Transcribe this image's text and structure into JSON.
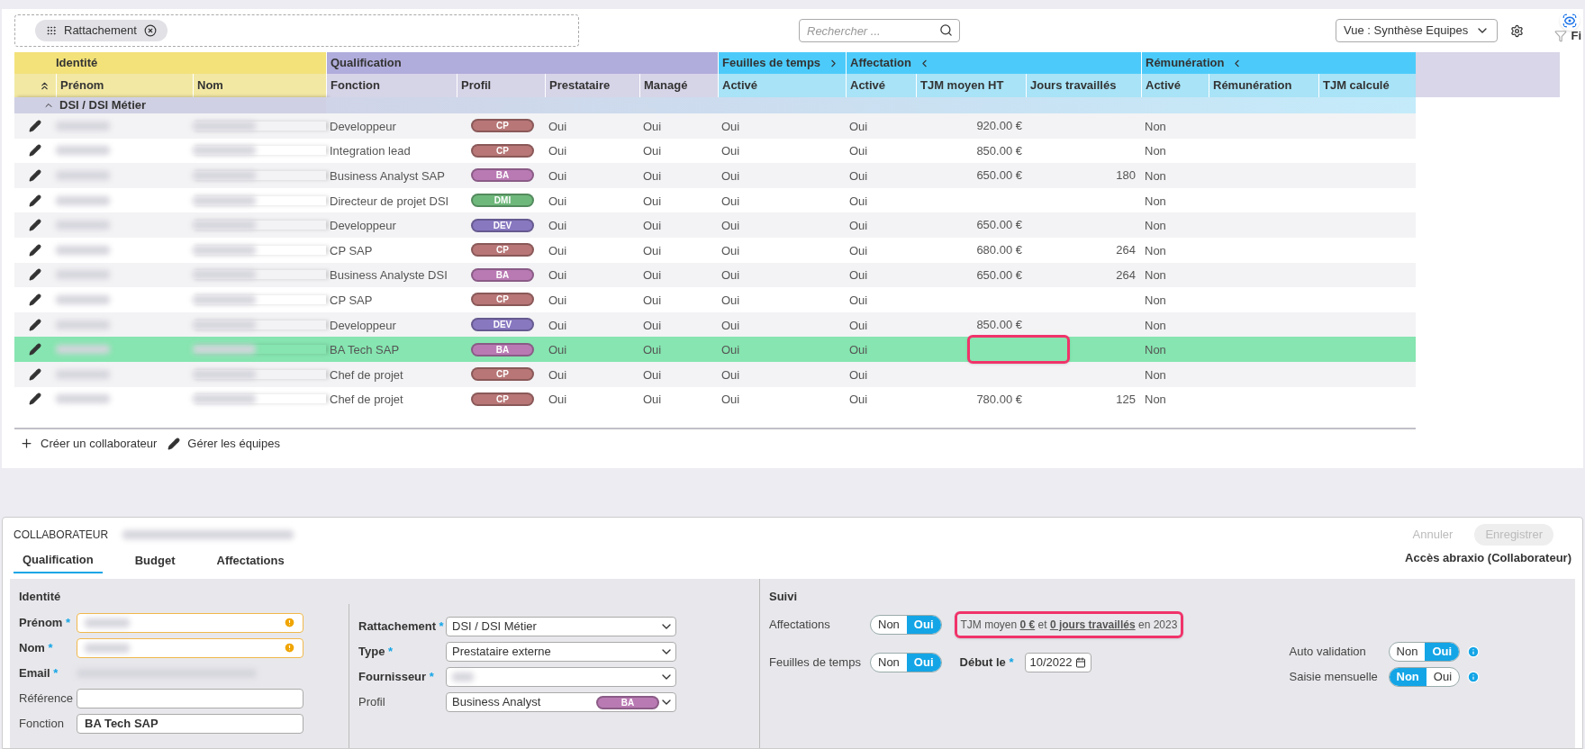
{
  "toolbar": {
    "group_chip": "Rattachement",
    "search": {
      "placeholder": "Rechercher ..."
    },
    "view_select": "Vue : Synthèse Equipes",
    "filter_label": "Fi"
  },
  "table": {
    "groups": [
      {
        "label": "Identité",
        "kind": "identite",
        "expandable": false,
        "collapsible": false
      },
      {
        "label": "Qualification",
        "kind": "qualification",
        "expandable": false,
        "collapsible": false
      },
      {
        "label": "Feuilles de temps",
        "kind": "suivi",
        "expandable": true,
        "collapsible": false
      },
      {
        "label": "Affectation",
        "kind": "suivi",
        "expandable": false,
        "collapsible": true
      },
      {
        "label": "Rémunération",
        "kind": "suivi",
        "expandable": false,
        "collapsible": true
      }
    ],
    "columns": [
      "Prénom",
      "Nom",
      "Fonction",
      "Profil",
      "Prestataire",
      "Managé",
      "Activé",
      "Activé",
      "TJM moyen HT",
      "Jours travaillés",
      "Activé",
      "Rémunération",
      "TJM calculé"
    ],
    "group_row": "DSI / DSI Métier",
    "rows": [
      {
        "fonction": "Developpeur",
        "profil": {
          "label": "CP",
          "color": "#b87676"
        },
        "prestataire": "Oui",
        "manage": "Oui",
        "ft_active": "Oui",
        "aff_active": "Oui",
        "tjm": "920.00 €",
        "jours": "",
        "rem_active": "Non",
        "selected": false,
        "annotated": false
      },
      {
        "fonction": "Integration lead",
        "profil": {
          "label": "CP",
          "color": "#b87676"
        },
        "prestataire": "Oui",
        "manage": "Oui",
        "ft_active": "Oui",
        "aff_active": "Oui",
        "tjm": "850.00 €",
        "jours": "",
        "rem_active": "Non",
        "selected": false,
        "annotated": false
      },
      {
        "fonction": "Business Analyst SAP",
        "profil": {
          "label": "BA",
          "color": "#b97ab3"
        },
        "prestataire": "Oui",
        "manage": "Oui",
        "ft_active": "Oui",
        "aff_active": "Oui",
        "tjm": "650.00 €",
        "jours": "180",
        "rem_active": "Non",
        "selected": false,
        "annotated": false
      },
      {
        "fonction": "Directeur de projet DSI",
        "profil": {
          "label": "DMI",
          "color": "#6fb87c"
        },
        "prestataire": "Oui",
        "manage": "Oui",
        "ft_active": "Oui",
        "aff_active": "Oui",
        "tjm": "",
        "jours": "",
        "rem_active": "Non",
        "selected": false,
        "annotated": false
      },
      {
        "fonction": "Developpeur",
        "profil": {
          "label": "DEV",
          "color": "#8878c0"
        },
        "prestataire": "Oui",
        "manage": "Oui",
        "ft_active": "Oui",
        "aff_active": "Oui",
        "tjm": "650.00 €",
        "jours": "",
        "rem_active": "Non",
        "selected": false,
        "annotated": false
      },
      {
        "fonction": "CP SAP",
        "profil": {
          "label": "CP",
          "color": "#b87676"
        },
        "prestataire": "Oui",
        "manage": "Oui",
        "ft_active": "Oui",
        "aff_active": "Oui",
        "tjm": "680.00 €",
        "jours": "264",
        "rem_active": "Non",
        "selected": false,
        "annotated": false
      },
      {
        "fonction": "Business Analyste DSI",
        "profil": {
          "label": "BA",
          "color": "#b97ab3"
        },
        "prestataire": "Oui",
        "manage": "Oui",
        "ft_active": "Oui",
        "aff_active": "Oui",
        "tjm": "650.00 €",
        "jours": "264",
        "rem_active": "Non",
        "selected": false,
        "annotated": false
      },
      {
        "fonction": "CP SAP",
        "profil": {
          "label": "CP",
          "color": "#b87676"
        },
        "prestataire": "Oui",
        "manage": "Oui",
        "ft_active": "Oui",
        "aff_active": "Oui",
        "tjm": "",
        "jours": "",
        "rem_active": "Non",
        "selected": false,
        "annotated": false
      },
      {
        "fonction": "Developpeur",
        "profil": {
          "label": "DEV",
          "color": "#8878c0"
        },
        "prestataire": "Oui",
        "manage": "Oui",
        "ft_active": "Oui",
        "aff_active": "Oui",
        "tjm": "850.00 €",
        "jours": "",
        "rem_active": "Non",
        "selected": false,
        "annotated": false
      },
      {
        "fonction": "BA Tech SAP",
        "profil": {
          "label": "BA",
          "color": "#b97ab3"
        },
        "prestataire": "Oui",
        "manage": "Oui",
        "ft_active": "Oui",
        "aff_active": "Oui",
        "tjm": "",
        "jours": "",
        "rem_active": "Non",
        "selected": true,
        "annotated": true
      },
      {
        "fonction": "Chef de projet",
        "profil": {
          "label": "CP",
          "color": "#b87676"
        },
        "prestataire": "Oui",
        "manage": "Oui",
        "ft_active": "Oui",
        "aff_active": "Oui",
        "tjm": "",
        "jours": "",
        "rem_active": "Non",
        "selected": false,
        "annotated": false
      },
      {
        "fonction": "Chef de projet",
        "profil": {
          "label": "CP",
          "color": "#b87676"
        },
        "prestataire": "Oui",
        "manage": "Oui",
        "ft_active": "Oui",
        "aff_active": "Oui",
        "tjm": "780.00 €",
        "jours": "125",
        "rem_active": "Non",
        "selected": false,
        "annotated": false
      }
    ],
    "actions": [
      "Créer un collaborateur",
      "Gérer les équipes"
    ]
  },
  "detail": {
    "title": "COLLABORATEUR",
    "cancel": "Annuler",
    "save": "Enregistrer",
    "access": "Accès abraxio (Collaborateur)",
    "tabs": [
      {
        "label": "Qualification",
        "selected": true
      },
      {
        "label": "Budget",
        "selected": false
      },
      {
        "label": "Affectations",
        "selected": false
      }
    ],
    "identite": {
      "title": "Identité",
      "fields": [
        {
          "label": "Prénom",
          "required": "*",
          "kind": "warning"
        },
        {
          "label": "Nom",
          "required": "*",
          "kind": "warning"
        },
        {
          "label": "Email",
          "required": "*",
          "kind": "redacted"
        },
        {
          "label": "Référence",
          "kind": "input"
        },
        {
          "label": "Fonction",
          "kind": "input",
          "value": "BA Tech SAP"
        }
      ]
    },
    "affectation": {
      "fields": [
        {
          "label": "Rattachement",
          "required": "*",
          "value": "DSI / DSI Métier"
        },
        {
          "label": "Type",
          "required": "*",
          "value": "Prestataire externe"
        },
        {
          "label": "Fournisseur",
          "required": "*"
        },
        {
          "label": "Profil",
          "value": "Business Analyst",
          "badge": {
            "label": "BA",
            "color": "#b97ab3"
          }
        }
      ]
    },
    "suivi": {
      "title": "Suivi",
      "affectations_label": "Affectations",
      "affectations_toggle": [
        {
          "label": "Non",
          "selected": false
        },
        {
          "label": "Oui",
          "selected": true
        }
      ],
      "summary": "TJM moyen **0 €** et **0 jours travaillés** en 2023",
      "summary_annotated": true,
      "feuilles_label": "Feuilles de temps",
      "feuilles_toggle": [
        {
          "label": "Non",
          "selected": false
        },
        {
          "label": "Oui",
          "selected": true
        }
      ],
      "debut_label": "Début le",
      "debut_required": "*",
      "debut": "10/2022",
      "auto_label": "Auto validation",
      "auto_toggle": [
        {
          "label": "Non",
          "selected": false
        },
        {
          "label": "Oui",
          "selected": true
        }
      ],
      "saisie_label": "Saisie mensuelle",
      "saisie_toggle": [
        {
          "label": "Non",
          "selected": true
        },
        {
          "label": "Oui",
          "selected": false
        }
      ]
    }
  }
}
